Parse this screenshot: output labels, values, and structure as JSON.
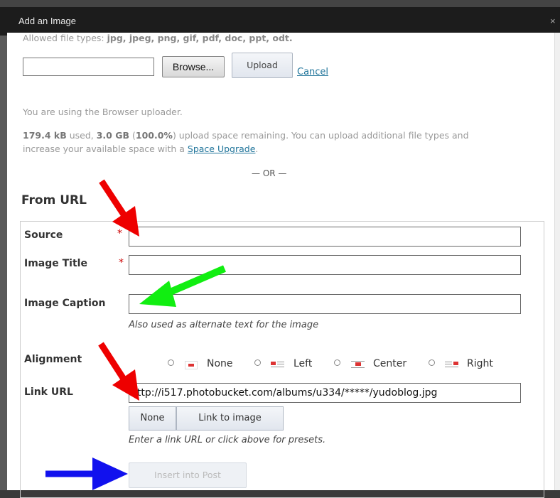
{
  "dialog": {
    "title": "Add an Image",
    "close_glyph": "×"
  },
  "upload": {
    "allowed_prefix": "Allowed file types: ",
    "allowed_types": "jpg, jpeg, png, gif, pdf, doc, ppt, odt.",
    "browse_label": "Browse...",
    "upload_label": "Upload",
    "cancel_label": "Cancel",
    "uploader_note": "You are using the Browser uploader.",
    "space_used": "179.4 kB",
    "space_used_suffix": " used, ",
    "space_remaining": "3.0 GB",
    "space_open": " (",
    "space_pct": "100.0%",
    "space_rest_line1": ") upload space remaining. You can upload additional file types and",
    "space_rest_line2": "increase your available space with a ",
    "space_upgrade_link": "Space Upgrade",
    "space_period": ".",
    "or_separator": "— OR —"
  },
  "from_url": {
    "heading": "From URL",
    "source_label": "Source",
    "image_title_label": "Image Title",
    "image_caption_label": "Image Caption",
    "required_marker": "*",
    "caption_help": "Also used as alternate text for the image",
    "alignment_label": "Alignment",
    "alignment_options": [
      "None",
      "Left",
      "Center",
      "Right"
    ],
    "link_url_label": "Link URL",
    "link_url_value": "http://i517.photobucket.com/albums/u334/*****/yudoblog.jpg",
    "link_none_button": "None",
    "link_to_image_button": "Link to image",
    "link_help": "Enter a link URL or click above for presets.",
    "insert_button": "Insert into Post"
  },
  "annotations": {
    "red_arrow_color": "#ee0000",
    "green_arrow_color": "#11ee11",
    "blue_arrow_color": "#1111ee"
  }
}
